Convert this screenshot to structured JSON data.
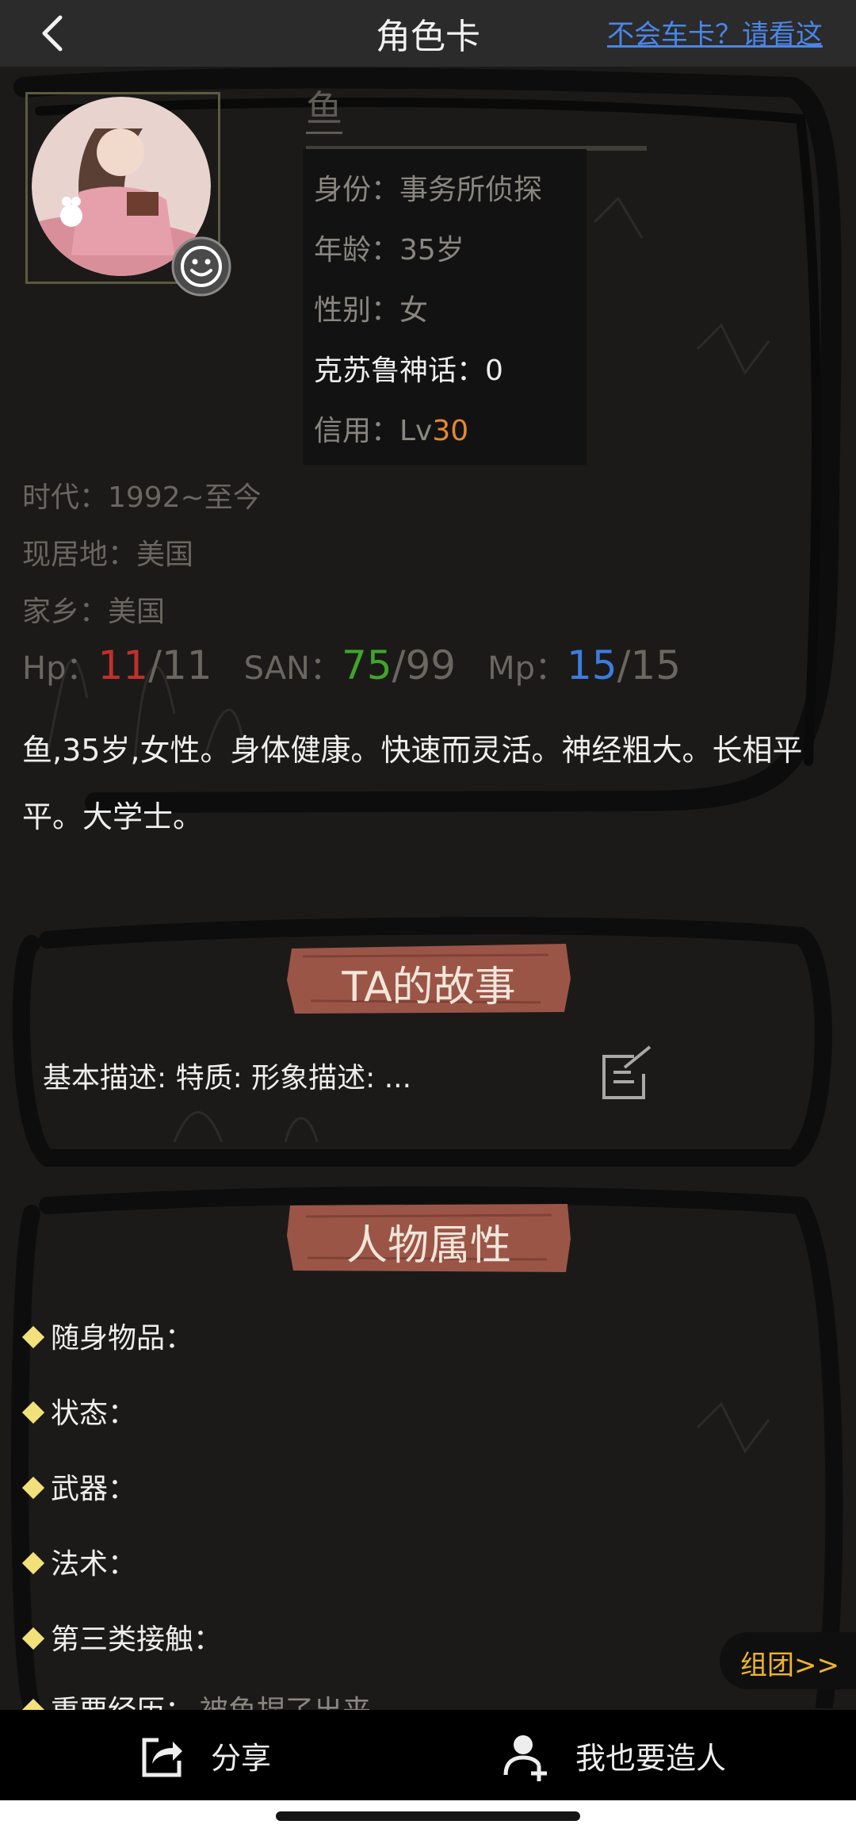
{
  "header": {
    "title": "角色卡",
    "help_link": "不会车卡？请看这"
  },
  "profile": {
    "name": "鱼",
    "identity": "身份：事务所侦探",
    "age": "年龄：35岁",
    "gender": "性别：女",
    "cthulhu": "克苏鲁神话：0",
    "credit_label": "信用：Lv",
    "credit_value": "30",
    "era": "时代：1992~至今",
    "residence": "现居地：美国",
    "hometown": "家乡：美国"
  },
  "stats": {
    "hp_label": "Hp：",
    "hp_current": "11",
    "hp_max": "/11",
    "san_label": "SAN：",
    "san_current": "75",
    "san_max": "/99",
    "mp_label": "Mp：",
    "mp_current": "15",
    "mp_max": "/15",
    "colors": {
      "hp": "#c0302c",
      "san": "#3fa52b",
      "mp": "#3d7ce0"
    }
  },
  "description": "鱼,35岁,女性。身体健康。快速而灵活。神经粗大。长相平平。大学士。",
  "story": {
    "title": "TA的故事",
    "text": "基本描述: 特质: 形象描述: ...",
    "edit_icon": "edit-icon"
  },
  "attributes": {
    "title": "人物属性",
    "items": [
      {
        "label": "随身物品：",
        "value": ""
      },
      {
        "label": "状态：",
        "value": ""
      },
      {
        "label": "武器：",
        "value": ""
      },
      {
        "label": "法术：",
        "value": ""
      },
      {
        "label": "第三类接触：",
        "value": ""
      },
      {
        "label": "重要经历：",
        "value": "被鱼捏了出来。。"
      }
    ]
  },
  "team_button": "组团>>",
  "bottom_bar": {
    "share": "分享",
    "create": "我也要造人"
  },
  "theme": {
    "accent": "#e5892f",
    "link": "#4a86e8",
    "banner": "#9b5547",
    "team": "#f0b428"
  }
}
